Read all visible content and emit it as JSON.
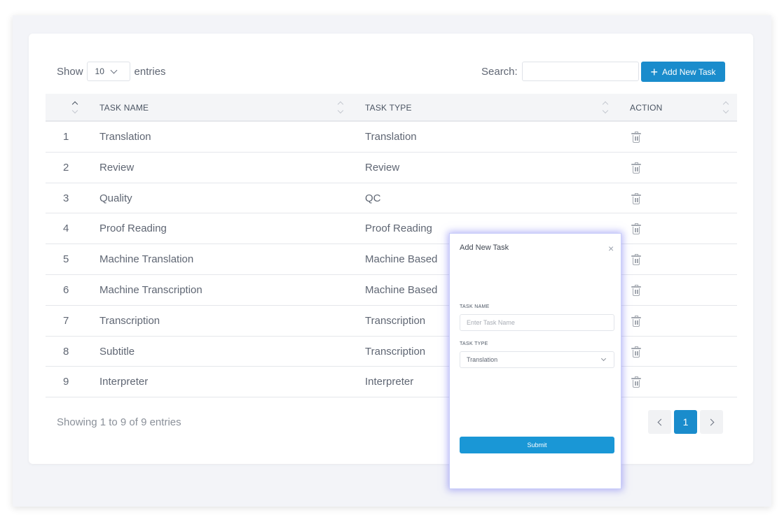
{
  "controls": {
    "show_label": "Show",
    "entries_per_page": "10",
    "entries_label": "entries",
    "search_label": "Search:",
    "search_value": "",
    "add_button_label": "Add New Task"
  },
  "table": {
    "columns": [
      "TASK NAME",
      "TASK TYPE",
      "ACTION"
    ],
    "rows": [
      {
        "index": "1",
        "name": "Translation",
        "type": "Translation"
      },
      {
        "index": "2",
        "name": "Review",
        "type": "Review"
      },
      {
        "index": "3",
        "name": "Quality",
        "type": "QC"
      },
      {
        "index": "4",
        "name": "Proof Reading",
        "type": "Proof Reading"
      },
      {
        "index": "5",
        "name": "Machine Translation",
        "type": "Machine Based"
      },
      {
        "index": "6",
        "name": "Machine Transcription",
        "type": "Machine Based"
      },
      {
        "index": "7",
        "name": "Transcription",
        "type": "Transcription"
      },
      {
        "index": "8",
        "name": "Subtitle",
        "type": "Transcription"
      },
      {
        "index": "9",
        "name": "Interpreter",
        "type": "Interpreter"
      }
    ]
  },
  "footer": {
    "info": "Showing 1 to 9 of 9 entries",
    "current_page": "1"
  },
  "modal": {
    "title": "Add New Task",
    "close_glyph": "×",
    "task_name_label": "TASK NAME",
    "task_name_placeholder": "Enter Task Name",
    "task_type_label": "TASK TYPE",
    "task_type_value": "Translation",
    "submit_label": "Submit"
  },
  "colors": {
    "accent": "#1a8ccc",
    "page_background": "#f3f4f8"
  }
}
